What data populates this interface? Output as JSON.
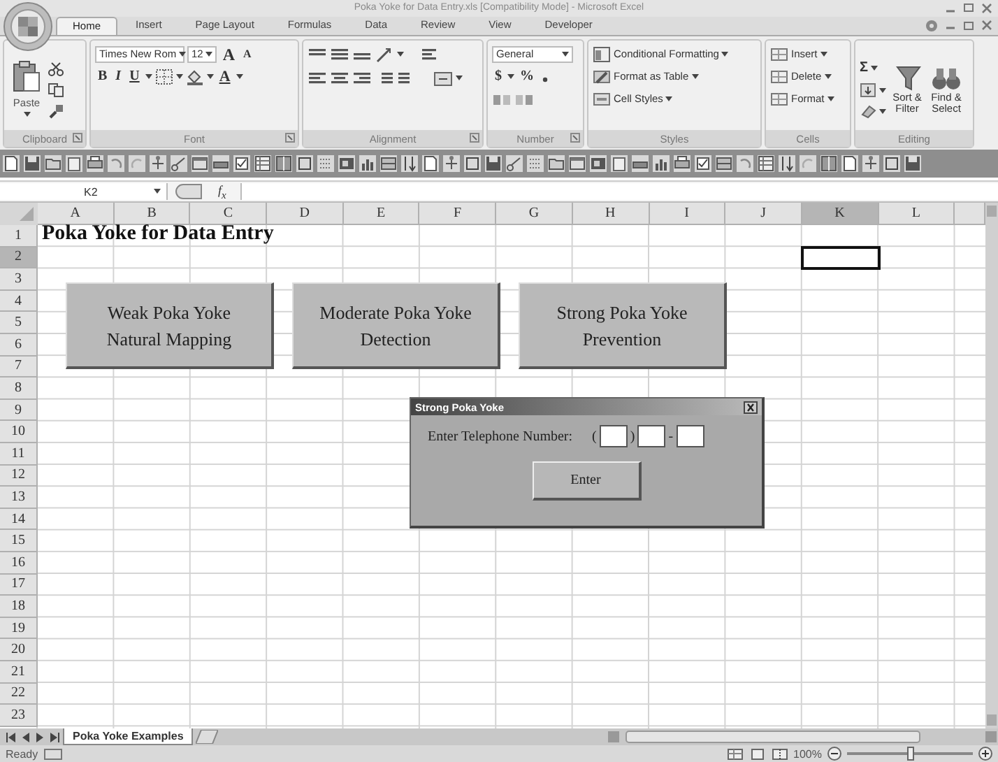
{
  "window": {
    "title": "Poka Yoke for Data Entry.xls  [Compatibility Mode] - Microsoft Excel"
  },
  "ribbon_tabs": [
    {
      "label": "Home",
      "selected": true
    },
    {
      "label": "Insert",
      "selected": false
    },
    {
      "label": "Page Layout",
      "selected": false
    },
    {
      "label": "Formulas",
      "selected": false
    },
    {
      "label": "Data",
      "selected": false
    },
    {
      "label": "Review",
      "selected": false
    },
    {
      "label": "View",
      "selected": false
    },
    {
      "label": "Developer",
      "selected": false
    }
  ],
  "ribbon": {
    "clipboard": {
      "paste": "Paste",
      "label": "Clipboard"
    },
    "font": {
      "name": "Times New Rom",
      "size": "12",
      "grow": "A",
      "shrink": "A",
      "bold": "B",
      "italic": "I",
      "underline": "U",
      "font_color": "A",
      "label": "Font"
    },
    "alignment": {
      "label": "Alignment"
    },
    "number": {
      "format": "General",
      "currency": "$",
      "percent": "%",
      "label": "Number"
    },
    "styles": {
      "items": [
        "Conditional Formatting",
        "Format as Table",
        "Cell Styles"
      ],
      "label": "Styles"
    },
    "cells": {
      "items": [
        "Insert",
        "Delete",
        "Format"
      ],
      "label": "Cells"
    },
    "editing": {
      "sum": "Σ",
      "sort": "Sort & Filter",
      "find": "Find & Select",
      "label": "Editing"
    }
  },
  "formula_bar": {
    "name_box": "K2",
    "fx": "f$_{x}$"
  },
  "sheet": {
    "columns": [
      {
        "label": "A",
        "selected": false
      },
      {
        "label": "B",
        "selected": false
      },
      {
        "label": "C",
        "selected": false
      },
      {
        "label": "D",
        "selected": false
      },
      {
        "label": "E",
        "selected": false
      },
      {
        "label": "F",
        "selected": false
      },
      {
        "label": "G",
        "selected": false
      },
      {
        "label": "H",
        "selected": false
      },
      {
        "label": "I",
        "selected": false
      },
      {
        "label": "J",
        "selected": false
      },
      {
        "label": "K",
        "selected": true
      },
      {
        "label": "L",
        "selected": false
      }
    ],
    "rows": [
      {
        "label": "1",
        "selected": false,
        "cells": [
          "Poka Yoke for Data Entry"
        ]
      },
      {
        "label": "2",
        "selected": true
      },
      {
        "label": "3",
        "selected": false
      },
      {
        "label": "4",
        "selected": false
      },
      {
        "label": "5",
        "selected": false
      },
      {
        "label": "6",
        "selected": false
      },
      {
        "label": "7",
        "selected": false
      },
      {
        "label": "8",
        "selected": false
      },
      {
        "label": "9",
        "selected": false
      },
      {
        "label": "10",
        "selected": false
      },
      {
        "label": "11",
        "selected": false
      },
      {
        "label": "12",
        "selected": false
      },
      {
        "label": "13",
        "selected": false
      },
      {
        "label": "14",
        "selected": false
      },
      {
        "label": "15",
        "selected": false
      },
      {
        "label": "16",
        "selected": false
      },
      {
        "label": "17",
        "selected": false
      },
      {
        "label": "18",
        "selected": false
      },
      {
        "label": "19",
        "selected": false
      },
      {
        "label": "20",
        "selected": false
      },
      {
        "label": "21",
        "selected": false
      },
      {
        "label": "22",
        "selected": false
      },
      {
        "label": "23",
        "selected": false
      }
    ],
    "buttons": [
      {
        "label": "Weak Poka Yoke\nNatural Mapping"
      },
      {
        "label": "Moderate Poka Yoke\nDetection"
      },
      {
        "label": "Strong Poka Yoke\nPrevention"
      }
    ],
    "dialog": {
      "title": "Strong Poka Yoke",
      "prompt": "Enter Telephone Number:",
      "open_paren": "(",
      "close_paren": ")",
      "dash": "-",
      "button": "Enter"
    }
  },
  "sheet_tabs": [
    {
      "label": "Poka Yoke Examples",
      "selected": true
    }
  ],
  "status_bar": {
    "text": "Ready",
    "zoom": "100%",
    "level": 0.5
  }
}
